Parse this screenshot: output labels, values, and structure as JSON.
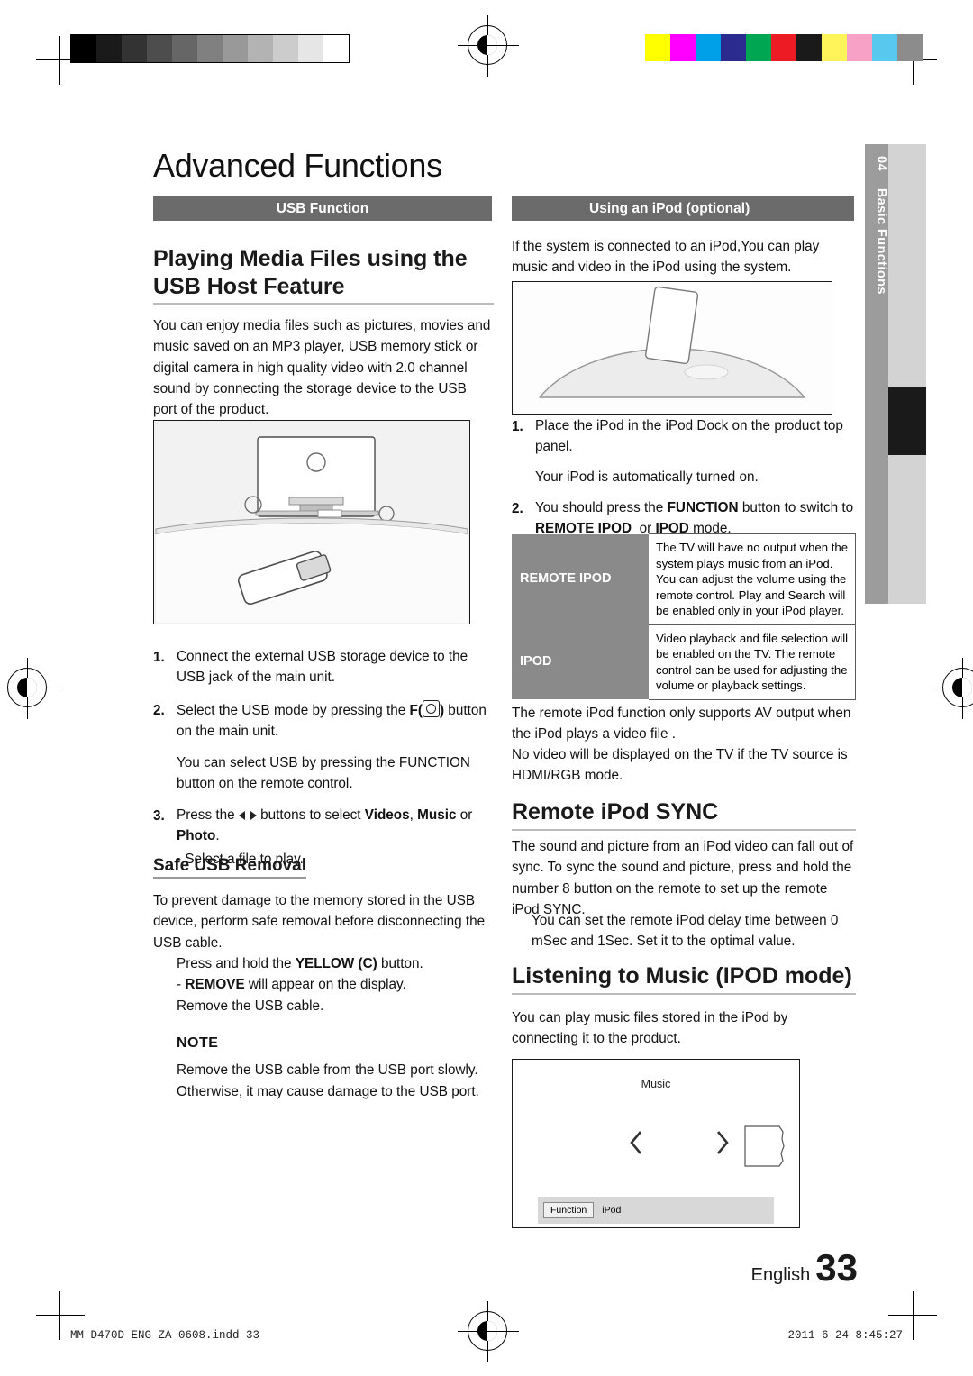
{
  "page": {
    "title": "Advanced Functions",
    "side_tab_number": "04",
    "side_tab_label": "Basic Functions",
    "footer_language": "English",
    "footer_page_number": "33",
    "footer_file": "MM-D470D-ENG-ZA-0608.indd   33",
    "footer_stamp": "2011-6-24   8:45:27"
  },
  "left_column": {
    "section_bar": "USB Function",
    "heading": "Playing Media Files using the USB Host Feature",
    "intro": "You can enjoy media files such as pictures, movies and music saved on an MP3 player, USB memory stick or digital camera in high quality video with 2.0 channel sound by connecting the storage device to the USB port of the product.",
    "steps": [
      {
        "num": "1.",
        "text": "Connect the external USB storage device to the USB jack of the main unit."
      },
      {
        "num": "2.",
        "text": "Select the USB mode by pressing the F(   ) button on the main unit."
      },
      {
        "num": "3.",
        "text": "Press the      buttons to select Videos, Music or Photo."
      }
    ],
    "step2_note": "You can select USB by pressing the FUNCTION button on the remote control.",
    "step3_note": "- Select a file to play.",
    "subheading": "Safe USB Removal",
    "safe_removal_text": "To prevent damage to the memory stored in the USB device, perform safe removal before disconnecting the USB cable.",
    "safe_removal_step1": "Press and hold the YELLOW (C) button.",
    "safe_removal_step2": "- REMOVE will appear on the display.",
    "safe_removal_step3": "Remove the USB cable.",
    "note_title": "NOTE",
    "note_text": "Remove the USB cable from the USB port slowly. Otherwise, it may cause damage to the USB port.",
    "inline": {
      "f_label": "F(",
      "f_label_close": ")",
      "videos": "Videos",
      "music": "Music",
      "or": "or",
      "photo": "Photo",
      "yellow": "YELLOW (C)",
      "remove": "REMOVE",
      "function_btn": "FUNCTION"
    }
  },
  "right_column": {
    "section_bar": "Using an iPod (optional)",
    "intro": "If the system is connected to an iPod,You can play music and video in the iPod using the system.",
    "steps": [
      {
        "num": "1.",
        "text": "Place the iPod in the iPod Dock on the product top panel."
      },
      {
        "num": "2.",
        "text": "You should press the FUNCTION button to switch to REMOTE IPOD  or IPOD mode."
      }
    ],
    "step1_note": "Your iPod is automatically turned on.",
    "table": {
      "rows": [
        {
          "label": "REMOTE IPOD",
          "desc": "The TV will have no output when the system plays music from an iPod.\nYou can adjust the volume using the remote control. Play and Search will be enabled only in your iPod player."
        },
        {
          "label": "IPOD",
          "desc": "Video playback and file selection will be enabled on the TV. The remote control can be used for adjusting the volume or playback settings."
        }
      ]
    },
    "after_table_1": "The remote iPod function only supports AV output when the iPod plays a video file .",
    "after_table_2": "No video will be displayed on the TV if the TV source is HDMI/RGB mode.",
    "sync_heading": "Remote iPod SYNC",
    "sync_text": "The sound and picture from an iPod video can fall out of sync. To sync the sound and picture, press and hold the number 8 button on the remote to set up the remote iPod SYNC.",
    "sync_note": "You can set the remote iPod delay time between 0 mSec and 1Sec. Set it to the optimal value.",
    "listening_heading": "Listening to Music (IPOD mode)",
    "listening_text": "You can play music files stored in the iPod by connecting it to the product.",
    "screen": {
      "title": "Music",
      "prev_icon": "chevron-left-icon",
      "next_icon": "chevron-right-icon",
      "button_function": "Function",
      "button_ipod": "iPod"
    },
    "inline": {
      "function_btn": "FUNCTION",
      "remote_ipod": "REMOTE IPOD",
      "ipod": "IPOD",
      "or": "or"
    }
  },
  "marks": {
    "grayscale": [
      "#000000",
      "#1a1a1a",
      "#333333",
      "#4d4d4d",
      "#666666",
      "#808080",
      "#999999",
      "#b3b3b3",
      "#cccccc",
      "#e6e6e6",
      "#ffffff"
    ],
    "colorbar": [
      "#ffff00",
      "#ff00ff",
      "#00a0e9",
      "#2b2b8f",
      "#00a651",
      "#ed1c24",
      "#1a1a1a",
      "#fff45a",
      "#f8a1c6",
      "#58c8ef",
      "#8c8c8c"
    ]
  }
}
